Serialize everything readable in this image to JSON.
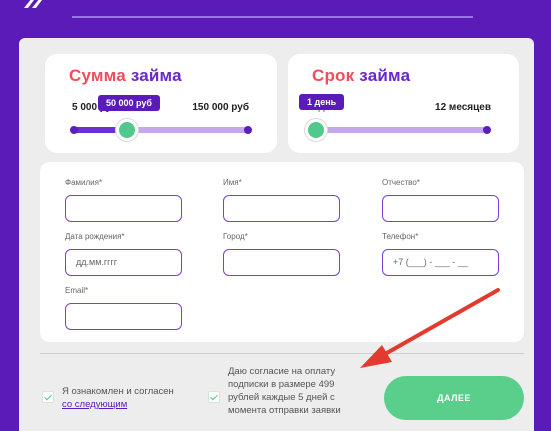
{
  "loan_amount": {
    "title_part1": "Сумма",
    "title_part2": "займа",
    "min_label": "5 000 руб",
    "max_label": "150 000 руб",
    "value_label": "50 000 руб",
    "fraction": 0.31
  },
  "loan_term": {
    "title_part1": "Срок",
    "title_part2": "займа",
    "min_label": "1 день",
    "max_label": "12 месяцев",
    "value_label": "1 день",
    "fraction": 0.0
  },
  "form": {
    "lastname_label": "Фамилия*",
    "firstname_label": "Имя*",
    "middlename_label": "Отчество*",
    "birthdate_label": "Дата рождения*",
    "birthdate_placeholder": "дд.мм.гггг",
    "city_label": "Город*",
    "phone_label": "Телефон*",
    "phone_placeholder": "+7 (___) - ___ - __",
    "email_label": "Email*"
  },
  "consent": {
    "terms_text": "Я ознакомлен и согласен",
    "terms_link": "со следующим",
    "subscription_text": "Даю согласие на оплату подписки в размере 499 рублей каждые 5 дней с момента отправки заявки"
  },
  "submit_label": "ДАЛЕЕ",
  "colors": {
    "brand_purple": "#5b1bb8",
    "accent_red": "#ee4e5c",
    "accent_green": "#52c98c"
  }
}
